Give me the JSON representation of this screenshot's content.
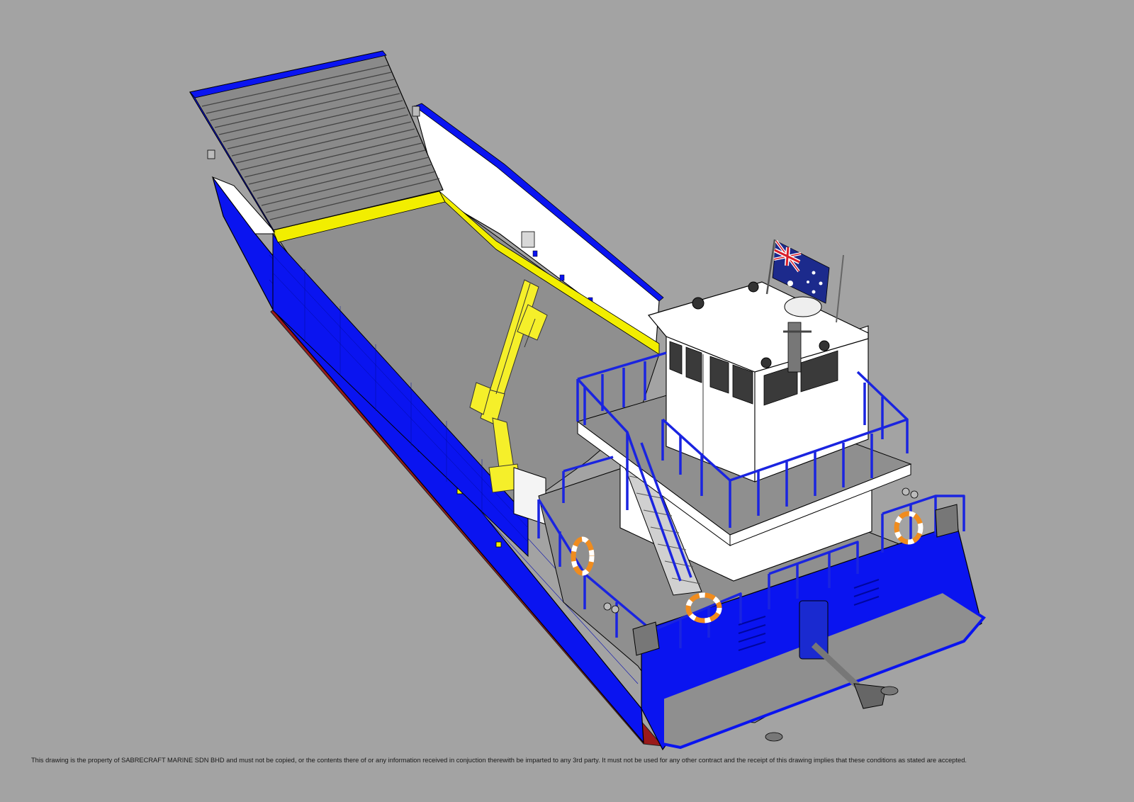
{
  "drawing": {
    "disclaimer": "This drawing is the property of SABRECRAFT MARINE SDN BHD and must not be copied, or the contents there of or any information received in conjuction therewith be imparted to any 3rd party. It must not be used for any other contract and the receipt of this drawing implies that these conditions as stated are accepted."
  },
  "colors": {
    "background": "#a3a3a3",
    "hull": "#0a14f0",
    "deck": "#8f8f8f",
    "deck_edge": "#f2ee00",
    "superstructure": "#ffffff",
    "railing": "#1a24e0",
    "crane": "#f5ef2a",
    "boot_stripe": "#9a1a1a",
    "lifebuoy": "#f08c1e"
  },
  "flag": {
    "country": "Australia"
  }
}
